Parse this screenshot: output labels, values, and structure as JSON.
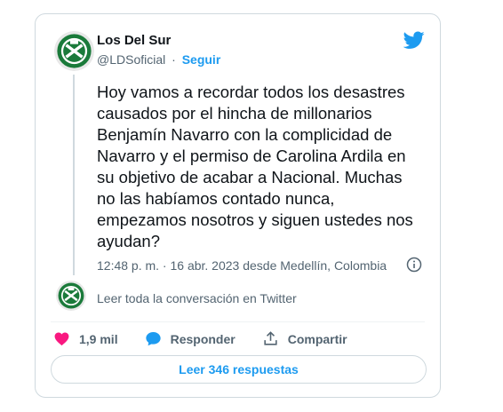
{
  "author": {
    "name": "Los Del Sur",
    "handle": "@LDSoficial",
    "separator": "·",
    "follow_label": "Seguir"
  },
  "tweet": {
    "text": "Hoy vamos a recordar todos los desastres\ncausados por el hincha de millonarios\nBenjamín Navarro con la complicidad de\nNavarro y el permiso de Carolina Ardila en\nsu objetivo de acabar a Nacional. Muchas\nno las habíamos contado nunca,\nempezamos nosotros y siguen ustedes nos\nayudan?",
    "timestamp": "12:48 p. m. · 16 abr. 2023 desde Medellín, Colombia"
  },
  "conversation_link": "Leer toda la conversación en Twitter",
  "actions": {
    "likes": "1,9 mil",
    "reply_label": "Responder",
    "share_label": "Compartir"
  },
  "replies_button": "Leer 346 respuestas",
  "colors": {
    "brand_blue": "#1d9bf0",
    "heart": "#f91880",
    "avatar_green": "#1a7a3a"
  },
  "icons": [
    "twitter-bird-icon",
    "info-icon",
    "heart-icon",
    "reply-bubble-icon",
    "share-icon"
  ]
}
